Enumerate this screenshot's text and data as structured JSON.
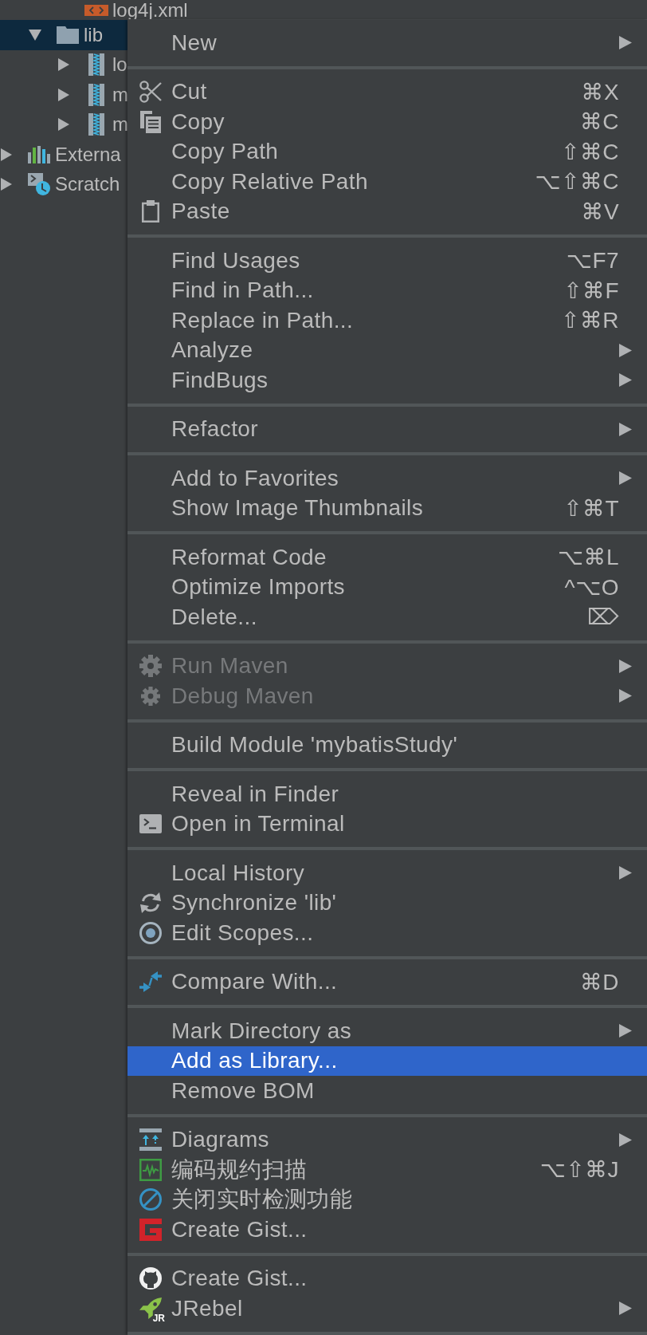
{
  "project_tree": [
    {
      "children": [
        {
          "children": [
            {
              "label": "log4j.xml",
              "kind": "file",
              "selected": false
            }
          ]
        },
        {
          "label": "lib",
          "kind": "folder",
          "expanded": true,
          "selected": true,
          "children": [
            {
              "label": "lo",
              "kind": "archive",
              "expanded": false,
              "selected": false
            },
            {
              "label": "m",
              "kind": "archive",
              "expanded": false,
              "selected": false
            },
            {
              "label": "m",
              "kind": "archive",
              "expanded": false,
              "selected": false
            }
          ]
        }
      ]
    },
    {
      "label": "Externa",
      "kind": "libraries",
      "expanded": false,
      "selected": false
    },
    {
      "label": "Scratch",
      "kind": "scratches",
      "expanded": false,
      "selected": false
    }
  ],
  "context_menu": {
    "sections": [
      {
        "items": [
          {
            "label": "New",
            "submenu": true,
            "disabled": false,
            "selected": false
          }
        ]
      },
      {
        "items": [
          {
            "label": "Cut",
            "shortcut": "⌘X",
            "submenu": false,
            "disabled": false,
            "selected": false
          },
          {
            "label": "Copy",
            "shortcut": "⌘C",
            "submenu": false,
            "disabled": false,
            "selected": false
          },
          {
            "label": "Copy Path",
            "shortcut": "⇧⌘C",
            "submenu": false,
            "disabled": false,
            "selected": false
          },
          {
            "label": "Copy Relative Path",
            "shortcut": "⌥⇧⌘C",
            "submenu": false,
            "disabled": false,
            "selected": false
          },
          {
            "label": "Paste",
            "shortcut": "⌘V",
            "submenu": false,
            "disabled": false,
            "selected": false
          }
        ]
      },
      {
        "items": [
          {
            "label": "Find Usages",
            "shortcut": "⌥F7",
            "submenu": false,
            "disabled": false,
            "selected": false
          },
          {
            "label": "Find in Path...",
            "shortcut": "⇧⌘F",
            "submenu": false,
            "disabled": false,
            "selected": false
          },
          {
            "label": "Replace in Path...",
            "shortcut": "⇧⌘R",
            "submenu": false,
            "disabled": false,
            "selected": false
          },
          {
            "label": "Analyze",
            "submenu": true,
            "disabled": false,
            "selected": false
          },
          {
            "label": "FindBugs",
            "submenu": true,
            "disabled": false,
            "selected": false
          }
        ]
      },
      {
        "items": [
          {
            "label": "Refactor",
            "submenu": true,
            "disabled": false,
            "selected": false
          }
        ]
      },
      {
        "items": [
          {
            "label": "Add to Favorites",
            "submenu": true,
            "disabled": false,
            "selected": false
          },
          {
            "label": "Show Image Thumbnails",
            "shortcut": "⇧⌘T",
            "submenu": false,
            "disabled": false,
            "selected": false
          }
        ]
      },
      {
        "items": [
          {
            "label": "Reformat Code",
            "shortcut": "⌥⌘L",
            "submenu": false,
            "disabled": false,
            "selected": false
          },
          {
            "label": "Optimize Imports",
            "shortcut": "^⌥O",
            "submenu": false,
            "disabled": false,
            "selected": false
          },
          {
            "label": "Delete...",
            "shortcut": "⌦",
            "submenu": false,
            "disabled": false,
            "selected": false
          }
        ]
      },
      {
        "items": [
          {
            "label": "Run Maven",
            "submenu": true,
            "disabled": true,
            "selected": false
          },
          {
            "label": "Debug Maven",
            "submenu": true,
            "disabled": true,
            "selected": false
          }
        ]
      },
      {
        "items": [
          {
            "label": "Build Module 'mybatisStudy'",
            "submenu": false,
            "disabled": false,
            "selected": false
          }
        ]
      },
      {
        "items": [
          {
            "label": "Reveal in Finder",
            "submenu": false,
            "disabled": false,
            "selected": false
          },
          {
            "label": "Open in Terminal",
            "submenu": false,
            "disabled": false,
            "selected": false
          }
        ]
      },
      {
        "items": [
          {
            "label": "Local History",
            "submenu": true,
            "disabled": false,
            "selected": false
          },
          {
            "label": "Synchronize 'lib'",
            "submenu": false,
            "disabled": false,
            "selected": false
          },
          {
            "label": "Edit Scopes...",
            "submenu": false,
            "disabled": false,
            "selected": false
          }
        ]
      },
      {
        "items": [
          {
            "label": "Compare With...",
            "shortcut": "⌘D",
            "submenu": false,
            "disabled": false,
            "selected": false
          }
        ]
      },
      {
        "items": [
          {
            "label": "Mark Directory as",
            "submenu": true,
            "disabled": false,
            "selected": false
          },
          {
            "label": "Add as Library...",
            "submenu": false,
            "disabled": false,
            "selected": true
          },
          {
            "label": "Remove BOM",
            "submenu": false,
            "disabled": false,
            "selected": false
          }
        ]
      },
      {
        "items": [
          {
            "label": "Diagrams",
            "submenu": true,
            "disabled": false,
            "selected": false
          },
          {
            "label": "编码规约扫描",
            "shortcut": "⌥⇧⌘J",
            "submenu": false,
            "disabled": false,
            "selected": false
          },
          {
            "label": "关闭实时检测功能",
            "submenu": false,
            "disabled": false,
            "selected": false
          },
          {
            "label": "Create Gist...",
            "submenu": false,
            "disabled": false,
            "selected": false
          }
        ]
      },
      {
        "items": [
          {
            "label": "Create Gist...",
            "submenu": false,
            "disabled": false,
            "selected": false
          },
          {
            "label": "JRebel",
            "badge": "JR",
            "submenu": true,
            "disabled": false,
            "selected": false
          }
        ]
      }
    ]
  }
}
